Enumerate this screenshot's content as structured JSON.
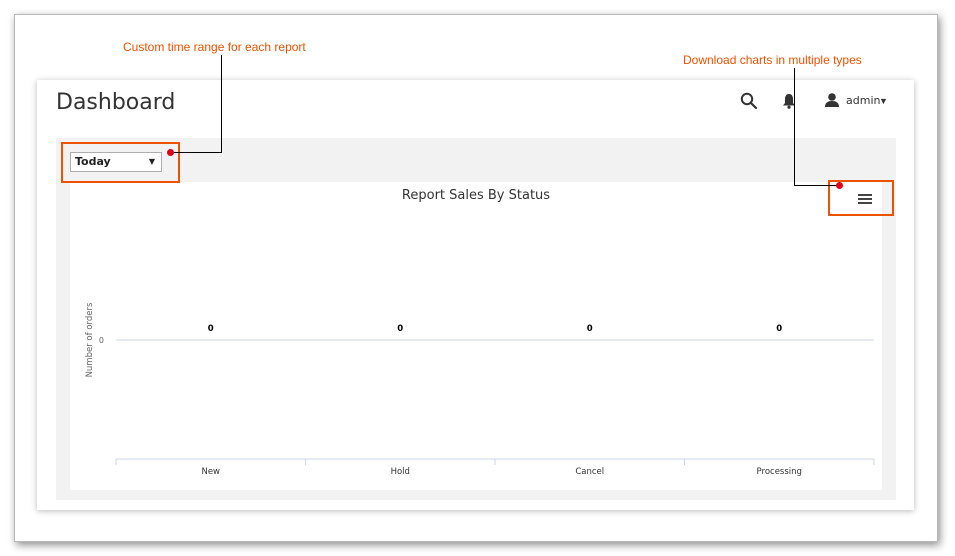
{
  "annotations": {
    "time_range": "Custom time range for each report",
    "download": "Download charts in multiple types"
  },
  "header": {
    "title": "Dashboard",
    "user": "admin"
  },
  "filter": {
    "selected": "Today"
  },
  "icons": {
    "search": "search-icon",
    "notifications": "bell-icon",
    "user": "user-icon",
    "menu": "hamburger-menu-icon"
  },
  "colors": {
    "accent": "#eb5202",
    "marker": "#e0001b",
    "grid": "#ccd6eb"
  },
  "chart_data": {
    "type": "bar",
    "title": "Report Sales By Status",
    "ylabel": "Number of orders",
    "xlabel": "",
    "categories": [
      "New",
      "Hold",
      "Cancel",
      "Processing"
    ],
    "values": [
      0,
      0,
      0,
      0
    ],
    "y_ticks": [
      "0"
    ],
    "legend": "none"
  }
}
